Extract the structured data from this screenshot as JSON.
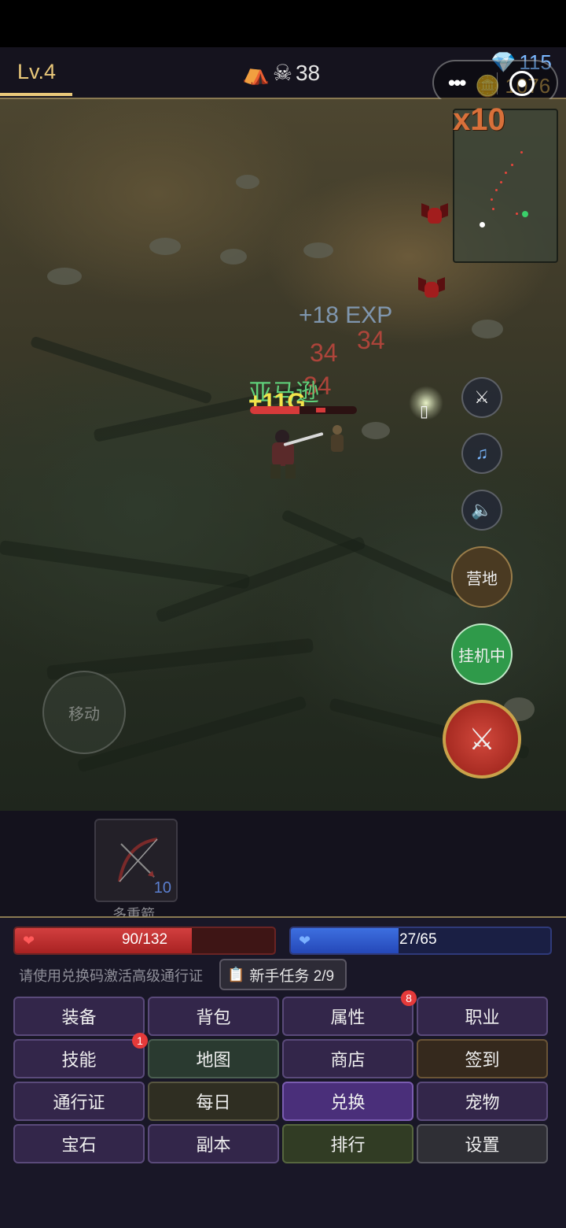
{
  "top": {
    "level": "Lv.4",
    "stage_icon": "⛺",
    "kill_icon": "☠",
    "kill_count": "38",
    "gems": "115",
    "gold": "1076"
  },
  "game": {
    "speed": "x10",
    "exp_text": "+18 EXP",
    "damage_1": "34",
    "damage_2": "34",
    "damage_3": "34",
    "player_name": "亚马逊",
    "gold_gain": "+11G",
    "joystick_label": "移动",
    "camp_label": "营地",
    "auto_label": "挂机中",
    "btn_icons": {
      "battle": "⚔",
      "music": "♫",
      "sound": "🔈",
      "attack": "⚔"
    }
  },
  "skill": {
    "name": "多重箭",
    "count": "10"
  },
  "stats": {
    "hp_text": "90/132",
    "hp": 90,
    "hp_max": 132,
    "mp_text": "27/65",
    "mp": 27,
    "mp_max": 65
  },
  "hint": "请使用兑换码激活高级通行证",
  "task": "新手任务 2/9",
  "menu": [
    {
      "label": "装备",
      "style": "c-purple"
    },
    {
      "label": "背包",
      "style": "c-purple"
    },
    {
      "label": "属性",
      "style": "c-purple",
      "badge": "8"
    },
    {
      "label": "职业",
      "style": "c-purple"
    },
    {
      "label": "技能",
      "style": "c-purple",
      "badge": "1"
    },
    {
      "label": "地图",
      "style": "c-green"
    },
    {
      "label": "商店",
      "style": "c-purple"
    },
    {
      "label": "签到",
      "style": "c-brown"
    },
    {
      "label": "通行证",
      "style": "c-purple"
    },
    {
      "label": "每日",
      "style": "c-olive"
    },
    {
      "label": "兑换",
      "style": "c-violet"
    },
    {
      "label": "宠物",
      "style": "c-purple"
    },
    {
      "label": "宝石",
      "style": "c-purple"
    },
    {
      "label": "副本",
      "style": "c-purple"
    },
    {
      "label": "排行",
      "style": "c-moss"
    },
    {
      "label": "设置",
      "style": "c-gray"
    }
  ]
}
